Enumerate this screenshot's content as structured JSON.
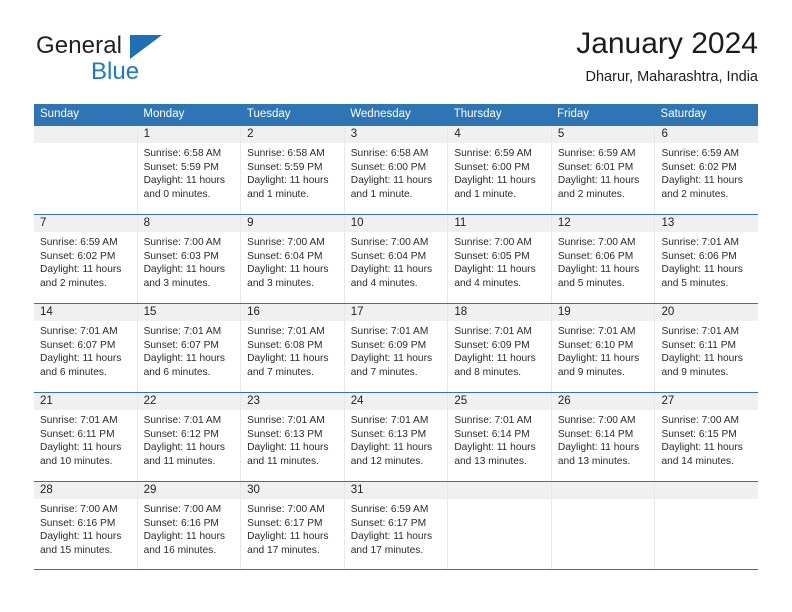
{
  "brand": {
    "name_part1": "General",
    "name_part2": "Blue",
    "triangle_icon": "triangle-icon",
    "accent_color": "#1a7cc4"
  },
  "header": {
    "title": "January 2024",
    "subtitle": "Dharur, Maharashtra, India"
  },
  "theme": {
    "header_band_color": "#2E75B6",
    "row_divider_color": "#2E75B6",
    "day_number_band_color": "#F0F0F0"
  },
  "weekdays": [
    "Sunday",
    "Monday",
    "Tuesday",
    "Wednesday",
    "Thursday",
    "Friday",
    "Saturday"
  ],
  "weeks": [
    [
      {
        "day": "",
        "sunrise": "",
        "sunset": "",
        "daylight": "",
        "empty": true
      },
      {
        "day": "1",
        "sunrise": "Sunrise: 6:58 AM",
        "sunset": "Sunset: 5:59 PM",
        "daylight": "Daylight: 11 hours and 0 minutes."
      },
      {
        "day": "2",
        "sunrise": "Sunrise: 6:58 AM",
        "sunset": "Sunset: 5:59 PM",
        "daylight": "Daylight: 11 hours and 1 minute."
      },
      {
        "day": "3",
        "sunrise": "Sunrise: 6:58 AM",
        "sunset": "Sunset: 6:00 PM",
        "daylight": "Daylight: 11 hours and 1 minute."
      },
      {
        "day": "4",
        "sunrise": "Sunrise: 6:59 AM",
        "sunset": "Sunset: 6:00 PM",
        "daylight": "Daylight: 11 hours and 1 minute."
      },
      {
        "day": "5",
        "sunrise": "Sunrise: 6:59 AM",
        "sunset": "Sunset: 6:01 PM",
        "daylight": "Daylight: 11 hours and 2 minutes."
      },
      {
        "day": "6",
        "sunrise": "Sunrise: 6:59 AM",
        "sunset": "Sunset: 6:02 PM",
        "daylight": "Daylight: 11 hours and 2 minutes."
      }
    ],
    [
      {
        "day": "7",
        "sunrise": "Sunrise: 6:59 AM",
        "sunset": "Sunset: 6:02 PM",
        "daylight": "Daylight: 11 hours and 2 minutes."
      },
      {
        "day": "8",
        "sunrise": "Sunrise: 7:00 AM",
        "sunset": "Sunset: 6:03 PM",
        "daylight": "Daylight: 11 hours and 3 minutes."
      },
      {
        "day": "9",
        "sunrise": "Sunrise: 7:00 AM",
        "sunset": "Sunset: 6:04 PM",
        "daylight": "Daylight: 11 hours and 3 minutes."
      },
      {
        "day": "10",
        "sunrise": "Sunrise: 7:00 AM",
        "sunset": "Sunset: 6:04 PM",
        "daylight": "Daylight: 11 hours and 4 minutes."
      },
      {
        "day": "11",
        "sunrise": "Sunrise: 7:00 AM",
        "sunset": "Sunset: 6:05 PM",
        "daylight": "Daylight: 11 hours and 4 minutes."
      },
      {
        "day": "12",
        "sunrise": "Sunrise: 7:00 AM",
        "sunset": "Sunset: 6:06 PM",
        "daylight": "Daylight: 11 hours and 5 minutes."
      },
      {
        "day": "13",
        "sunrise": "Sunrise: 7:01 AM",
        "sunset": "Sunset: 6:06 PM",
        "daylight": "Daylight: 11 hours and 5 minutes."
      }
    ],
    [
      {
        "day": "14",
        "sunrise": "Sunrise: 7:01 AM",
        "sunset": "Sunset: 6:07 PM",
        "daylight": "Daylight: 11 hours and 6 minutes."
      },
      {
        "day": "15",
        "sunrise": "Sunrise: 7:01 AM",
        "sunset": "Sunset: 6:07 PM",
        "daylight": "Daylight: 11 hours and 6 minutes."
      },
      {
        "day": "16",
        "sunrise": "Sunrise: 7:01 AM",
        "sunset": "Sunset: 6:08 PM",
        "daylight": "Daylight: 11 hours and 7 minutes."
      },
      {
        "day": "17",
        "sunrise": "Sunrise: 7:01 AM",
        "sunset": "Sunset: 6:09 PM",
        "daylight": "Daylight: 11 hours and 7 minutes."
      },
      {
        "day": "18",
        "sunrise": "Sunrise: 7:01 AM",
        "sunset": "Sunset: 6:09 PM",
        "daylight": "Daylight: 11 hours and 8 minutes."
      },
      {
        "day": "19",
        "sunrise": "Sunrise: 7:01 AM",
        "sunset": "Sunset: 6:10 PM",
        "daylight": "Daylight: 11 hours and 9 minutes."
      },
      {
        "day": "20",
        "sunrise": "Sunrise: 7:01 AM",
        "sunset": "Sunset: 6:11 PM",
        "daylight": "Daylight: 11 hours and 9 minutes."
      }
    ],
    [
      {
        "day": "21",
        "sunrise": "Sunrise: 7:01 AM",
        "sunset": "Sunset: 6:11 PM",
        "daylight": "Daylight: 11 hours and 10 minutes."
      },
      {
        "day": "22",
        "sunrise": "Sunrise: 7:01 AM",
        "sunset": "Sunset: 6:12 PM",
        "daylight": "Daylight: 11 hours and 11 minutes."
      },
      {
        "day": "23",
        "sunrise": "Sunrise: 7:01 AM",
        "sunset": "Sunset: 6:13 PM",
        "daylight": "Daylight: 11 hours and 11 minutes."
      },
      {
        "day": "24",
        "sunrise": "Sunrise: 7:01 AM",
        "sunset": "Sunset: 6:13 PM",
        "daylight": "Daylight: 11 hours and 12 minutes."
      },
      {
        "day": "25",
        "sunrise": "Sunrise: 7:01 AM",
        "sunset": "Sunset: 6:14 PM",
        "daylight": "Daylight: 11 hours and 13 minutes."
      },
      {
        "day": "26",
        "sunrise": "Sunrise: 7:00 AM",
        "sunset": "Sunset: 6:14 PM",
        "daylight": "Daylight: 11 hours and 13 minutes."
      },
      {
        "day": "27",
        "sunrise": "Sunrise: 7:00 AM",
        "sunset": "Sunset: 6:15 PM",
        "daylight": "Daylight: 11 hours and 14 minutes."
      }
    ],
    [
      {
        "day": "28",
        "sunrise": "Sunrise: 7:00 AM",
        "sunset": "Sunset: 6:16 PM",
        "daylight": "Daylight: 11 hours and 15 minutes."
      },
      {
        "day": "29",
        "sunrise": "Sunrise: 7:00 AM",
        "sunset": "Sunset: 6:16 PM",
        "daylight": "Daylight: 11 hours and 16 minutes."
      },
      {
        "day": "30",
        "sunrise": "Sunrise: 7:00 AM",
        "sunset": "Sunset: 6:17 PM",
        "daylight": "Daylight: 11 hours and 17 minutes."
      },
      {
        "day": "31",
        "sunrise": "Sunrise: 6:59 AM",
        "sunset": "Sunset: 6:17 PM",
        "daylight": "Daylight: 11 hours and 17 minutes."
      },
      {
        "day": "",
        "sunrise": "",
        "sunset": "",
        "daylight": "",
        "empty": true
      },
      {
        "day": "",
        "sunrise": "",
        "sunset": "",
        "daylight": "",
        "empty": true
      },
      {
        "day": "",
        "sunrise": "",
        "sunset": "",
        "daylight": "",
        "empty": true
      }
    ]
  ]
}
